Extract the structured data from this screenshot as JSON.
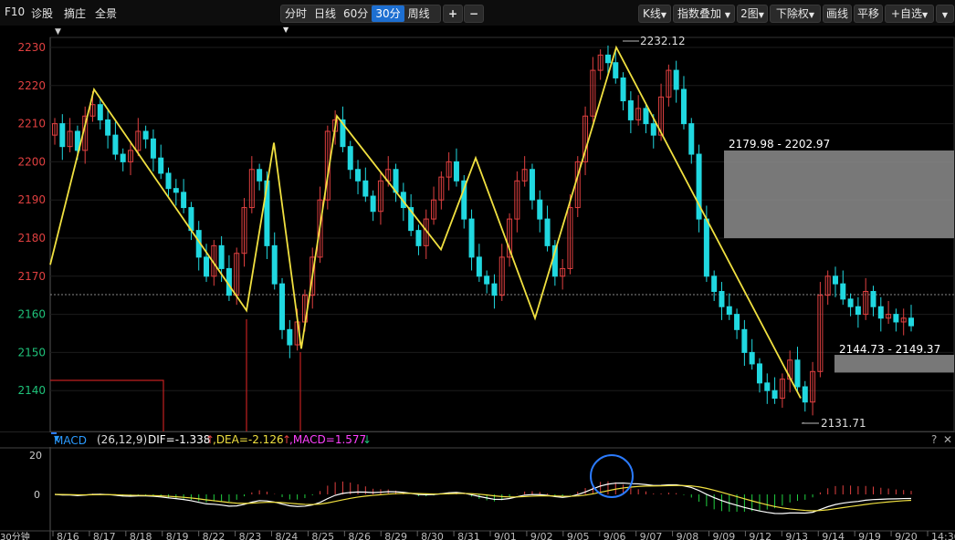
{
  "toolbar": {
    "f10": "F10",
    "diagnose": "诊股",
    "summary": "摘庄",
    "panorama": "全景",
    "periods": [
      "分时",
      "日线",
      "60分",
      "30分",
      "周线"
    ],
    "active_period": "30分",
    "zoom_in": "+",
    "zoom_out": "−",
    "kline": "K线",
    "index_overlay": "指数叠加",
    "two_charts": "2图",
    "ex_rights": "下除权",
    "draw_line": "画线",
    "pan": "平移",
    "custom": "+自选"
  },
  "price_axis": {
    "ticks": [
      "2230",
      "2220",
      "2210",
      "2200",
      "2190",
      "2180",
      "2170",
      "2160",
      "2150",
      "2140"
    ],
    "up_color": "#e04040",
    "down_color": "#1fc27a"
  },
  "annotations": {
    "high": "2232.12",
    "low": "2131.71",
    "zone_upper": "2179.98 - 2202.97",
    "zone_lower": "2144.73 - 2149.37"
  },
  "macd": {
    "name": "MACD",
    "params": "(26,12,9)",
    "dif": "DIF=-1.338",
    "dea": ",DEA=-2.126",
    "macd": ",MACD=1.577",
    "dif_color": "#ffffff",
    "dea_color": "#ffff40",
    "macd_color": "#ff40ff",
    "axis_ticks": [
      "20",
      "0"
    ]
  },
  "date_axis": {
    "period_label": "30分钟",
    "dates": [
      "8/16",
      "8/17",
      "8/18",
      "8/19",
      "8/22",
      "8/23",
      "8/24",
      "8/25",
      "8/26",
      "8/29",
      "8/30",
      "8/31",
      "9/01",
      "9/02",
      "9/05",
      "9/06",
      "9/07",
      "9/08",
      "9/09",
      "9/12",
      "9/13",
      "9/14",
      "9/19",
      "9/20",
      "14:30"
    ]
  },
  "chart_data": {
    "type": "candlestick",
    "ylim": [
      2128,
      2234
    ],
    "zigzag": [
      2173,
      2219,
      2161,
      2205,
      2151,
      2212,
      2177,
      2201,
      2159,
      2230,
      2138
    ],
    "closes": [
      2210,
      2204,
      2208,
      2203,
      2212,
      2215,
      2211,
      2207,
      2202,
      2200,
      2203,
      2208,
      2206,
      2201,
      2197,
      2193,
      2192,
      2188,
      2182,
      2175,
      2170,
      2178,
      2172,
      2165,
      2176,
      2188,
      2198,
      2195,
      2178,
      2168,
      2156,
      2152,
      2158,
      2165,
      2175,
      2190,
      2208,
      2211,
      2204,
      2198,
      2195,
      2191,
      2187,
      2195,
      2198,
      2192,
      2188,
      2182,
      2178,
      2185,
      2190,
      2196,
      2200,
      2195,
      2185,
      2175,
      2170,
      2168,
      2165,
      2175,
      2185,
      2195,
      2198,
      2190,
      2185,
      2178,
      2170,
      2172,
      2188,
      2200,
      2212,
      2224,
      2228,
      2226,
      2222,
      2216,
      2211,
      2214,
      2210,
      2207,
      2217,
      2224,
      2219,
      2210,
      2202,
      2185,
      2170,
      2166,
      2162,
      2160,
      2156,
      2150,
      2147,
      2142,
      2140,
      2138,
      2143,
      2148,
      2141,
      2137,
      2145,
      2165,
      2170,
      2168,
      2164,
      2162,
      2160,
      2166,
      2162,
      2159,
      2160,
      2158,
      2159,
      2157
    ]
  }
}
